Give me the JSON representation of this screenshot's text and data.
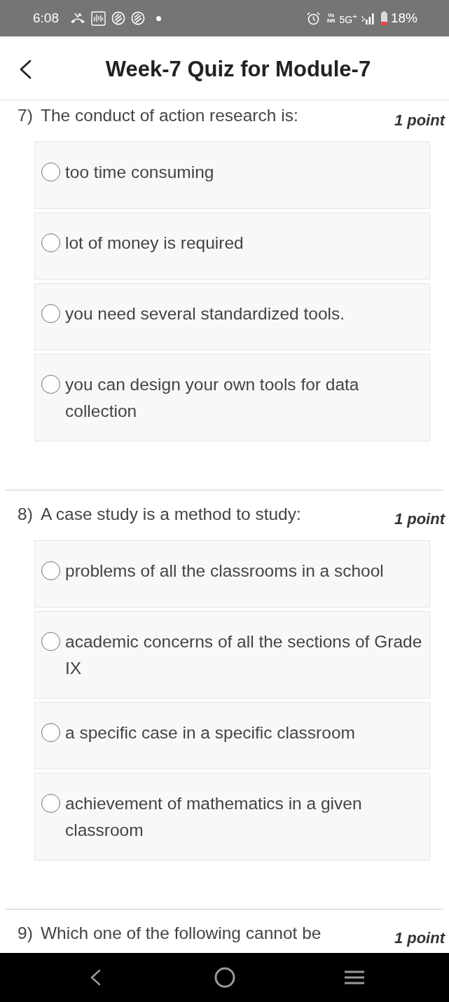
{
  "status_bar": {
    "time": "6:08",
    "voice_label": [
      "Vo",
      "NR"
    ],
    "network": "5G$^{+}$",
    "battery": "18%"
  },
  "header": {
    "title": "Week-7 Quiz for Module-7"
  },
  "questions": [
    {
      "number": "7)",
      "text": "The conduct of action research is:",
      "points": "1 point",
      "options": [
        {
          "label": "too time consuming",
          "selected": false
        },
        {
          "label": "lot of money is required",
          "selected": false
        },
        {
          "label": "you need several standardized tools.",
          "selected": false
        },
        {
          "label": "you can design your own tools for data collection",
          "selected": false
        }
      ]
    },
    {
      "number": "8)",
      "text": "A case study is a method to study:",
      "points": "1 point",
      "options": [
        {
          "label": "problems of all the classrooms in a school",
          "selected": false
        },
        {
          "label": "academic concerns of all the sections of Grade IX",
          "selected": false
        },
        {
          "label": "a specific case in a specific classroom",
          "selected": false
        },
        {
          "label": "achievement of mathematics in a given classroom",
          "selected": false
        }
      ]
    },
    {
      "number": "9)",
      "text": "Which one of the following cannot be",
      "points": "1 point"
    }
  ]
}
